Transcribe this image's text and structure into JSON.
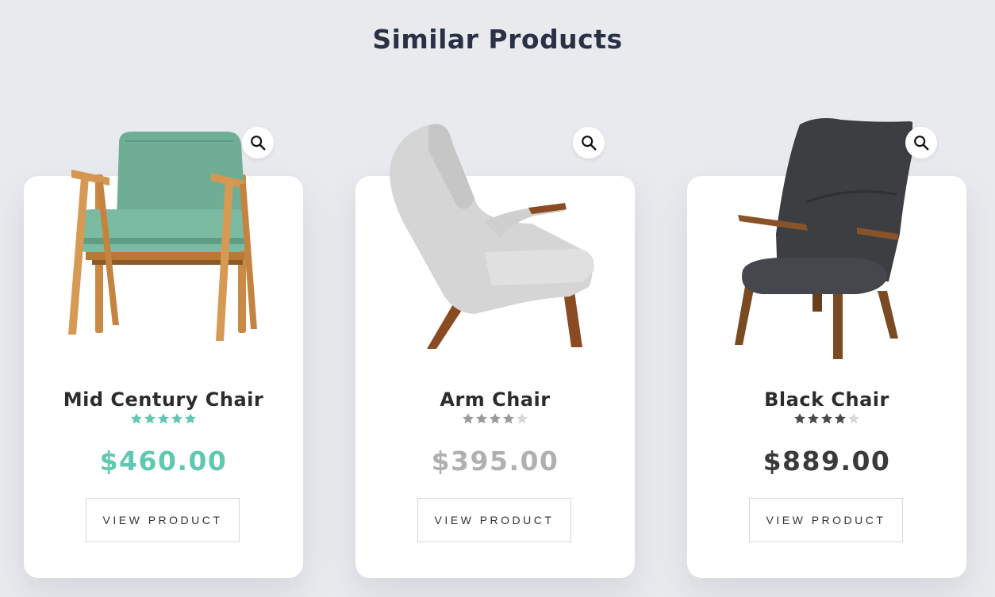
{
  "header": {
    "title": "Similar Products"
  },
  "products": [
    {
      "name": "Mid Century Chair",
      "rating": 5,
      "rating_max": 5,
      "price": "$460.00",
      "price_color": "#5ec8b0",
      "star_color": "#5ec8b0",
      "button_label": "VIEW PRODUCT"
    },
    {
      "name": "Arm Chair",
      "rating": 4,
      "rating_max": 5,
      "price": "$395.00",
      "price_color": "#b0b0b0",
      "star_color": "#9a9a9a",
      "button_label": "VIEW PRODUCT"
    },
    {
      "name": "Black Chair",
      "rating": 4,
      "rating_max": 5,
      "price": "$889.00",
      "price_color": "#3a3a3a",
      "star_color": "#4a4a4a",
      "button_label": "VIEW PRODUCT"
    }
  ],
  "icons": {
    "zoom": "magnifier-icon",
    "star": "star-icon"
  }
}
